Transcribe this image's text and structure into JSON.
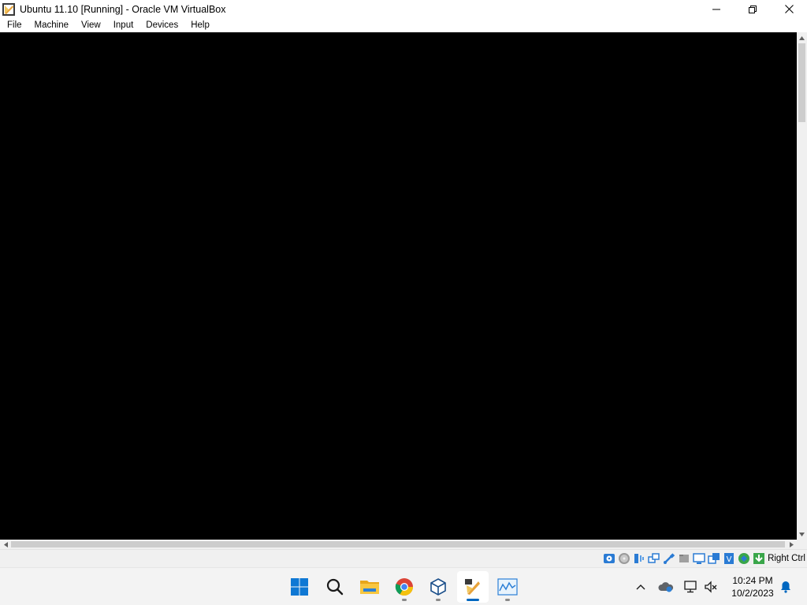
{
  "window": {
    "title": "Ubuntu 11.10 [Running] - Oracle VM VirtualBox",
    "controls": [
      "minimize",
      "maximize",
      "close"
    ]
  },
  "menubar": {
    "items": [
      "File",
      "Machine",
      "View",
      "Input",
      "Devices",
      "Help"
    ]
  },
  "vm_screen": {
    "background": "#000000"
  },
  "statusbar": {
    "icons": [
      "hard-disk-icon",
      "optical-disk-icon",
      "audio-icon",
      "network-icon",
      "usb-icon",
      "shared-folders-icon",
      "display-icon",
      "video-capture-icon",
      "virtualization-icon",
      "mouse-integration-icon",
      "keyboard-icon"
    ],
    "host_key": "Right Ctrl"
  },
  "taskbar": {
    "apps": [
      "start-button",
      "search-button",
      "file-explorer",
      "google-chrome",
      "virtualbox-manager",
      "virtualbox-vm",
      "task-manager"
    ],
    "active_app": "virtualbox-vm",
    "clock": {
      "time": "10:24 PM",
      "date": "10/2/2023"
    }
  },
  "colors": {
    "accent": "#0067c0",
    "taskbar_bg": "#f3f3f3",
    "chrome_bg": "#ffffff"
  }
}
